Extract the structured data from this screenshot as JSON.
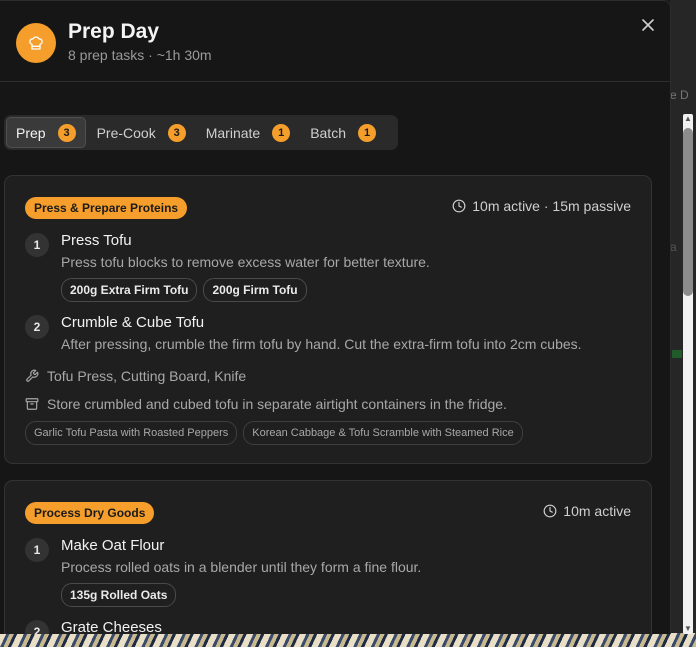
{
  "header": {
    "title": "Prep Day",
    "subtitle": "8 prep tasks · ~1h 30m",
    "logo_icon": "chef-hat-icon",
    "close_icon": "close-icon"
  },
  "tabs": [
    {
      "label": "Prep",
      "count": "3",
      "active": true
    },
    {
      "label": "Pre-Cook",
      "count": "3",
      "active": false
    },
    {
      "label": "Marinate",
      "count": "1",
      "active": false
    },
    {
      "label": "Batch",
      "count": "1",
      "active": false
    }
  ],
  "cards": [
    {
      "tag": "Press & Prepare Proteins",
      "time": "10m active · 15m passive",
      "steps": [
        {
          "num": "1",
          "title": "Press Tofu",
          "desc": "Press tofu blocks to remove excess water for better texture.",
          "chips": [
            "200g Extra Firm Tofu",
            "200g Firm Tofu"
          ]
        },
        {
          "num": "2",
          "title": "Crumble & Cube Tofu",
          "desc": "After pressing, crumble the firm tofu by hand. Cut the extra-firm tofu into 2cm cubes.",
          "chips": []
        }
      ],
      "equipment": "Tofu Press, Cutting Board, Knife",
      "storage": "Store crumbled and cubed tofu in separate airtight containers in the fridge.",
      "recipes": [
        "Garlic Tofu Pasta with Roasted Peppers",
        "Korean Cabbage & Tofu Scramble with Steamed Rice"
      ]
    },
    {
      "tag": "Process Dry Goods",
      "time": "10m active",
      "steps": [
        {
          "num": "1",
          "title": "Make Oat Flour",
          "desc": "Process rolled oats in a blender until they form a fine flour.",
          "chips": [
            "135g Rolled Oats"
          ]
        },
        {
          "num": "2",
          "title": "Grate Cheeses",
          "desc": "",
          "chips": []
        }
      ]
    }
  ],
  "colors": {
    "accent": "#f59e2b",
    "background": "#161616",
    "card": "#1f1f1f"
  }
}
